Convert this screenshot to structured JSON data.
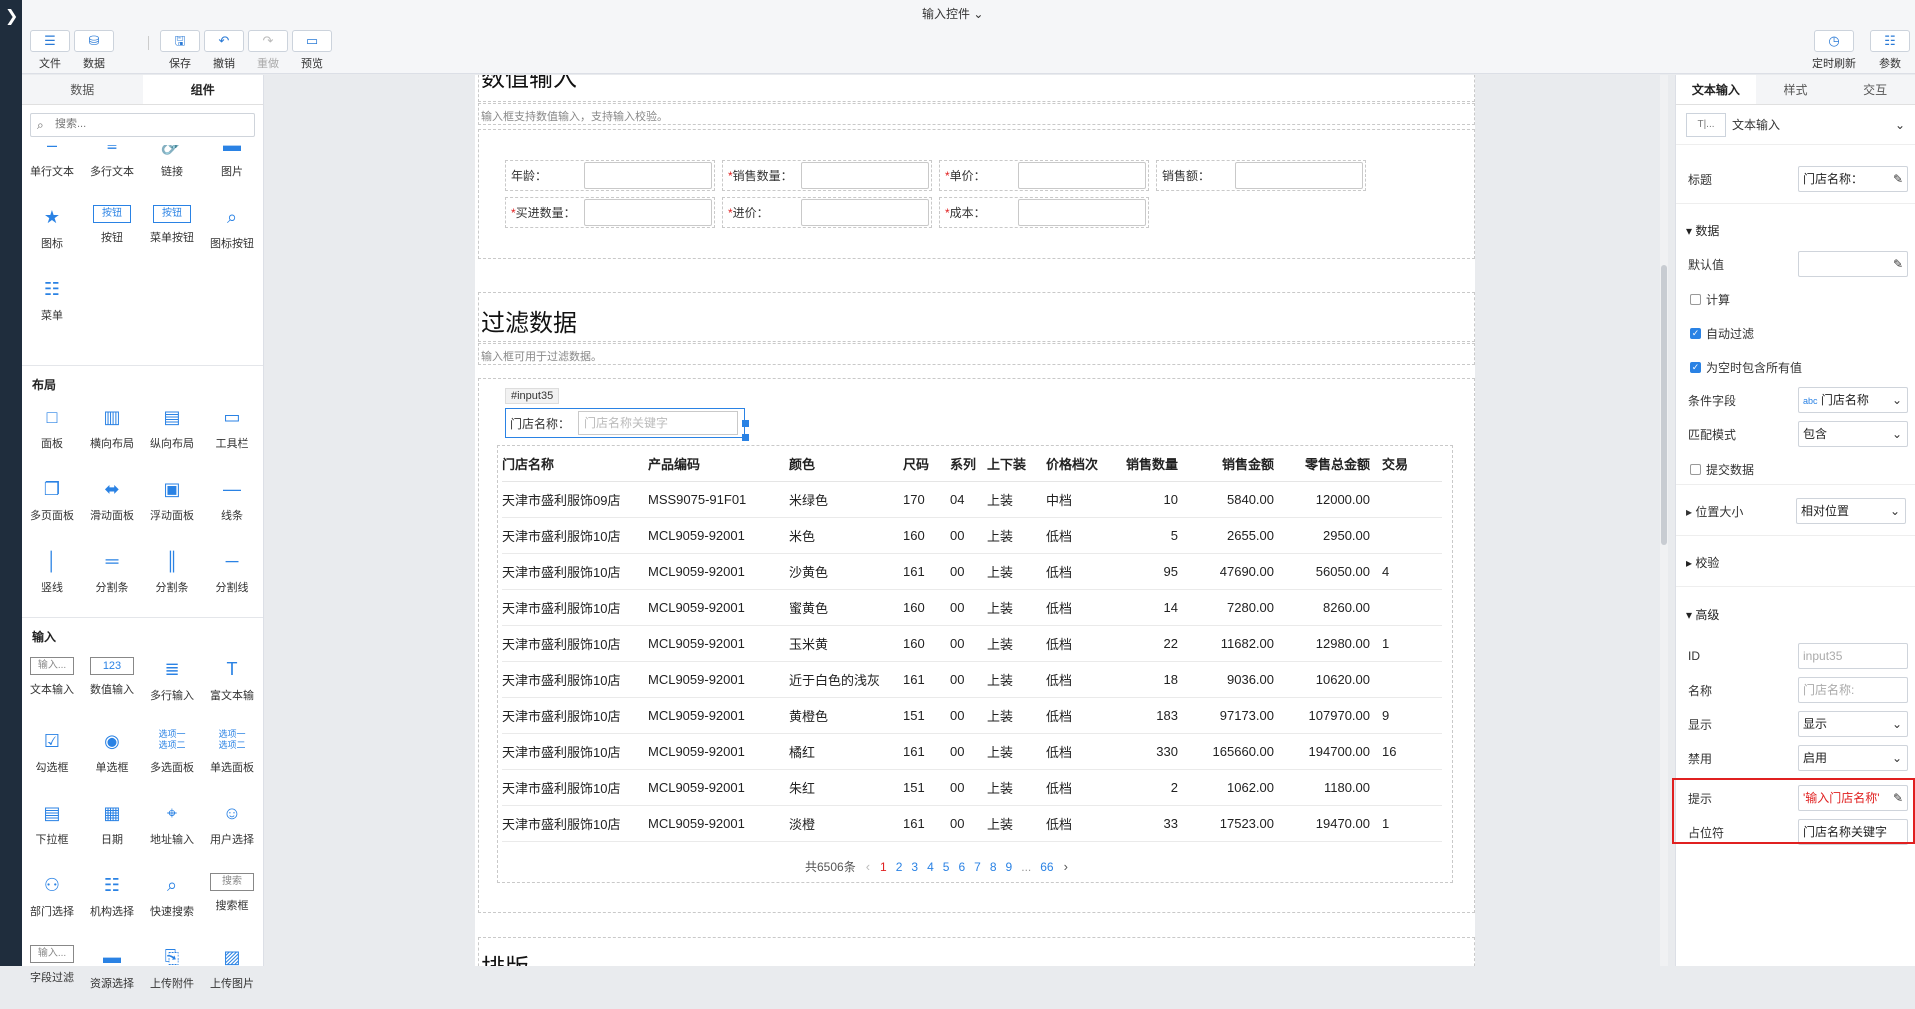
{
  "window_title": "输入控件",
  "toolbar": {
    "file": "文件",
    "data": "数据",
    "save": "保存",
    "undo": "撤销",
    "redo": "重做",
    "preview": "预览",
    "timed_refresh": "定时刷新",
    "params": "参数"
  },
  "left_panel": {
    "tabs": [
      "数据",
      "组件"
    ],
    "search_placeholder": "搜索...",
    "basic_items": [
      "单行文本",
      "多行文本",
      "链接",
      "图片",
      "图标",
      "按钮",
      "菜单按钮",
      "图标按钮",
      "菜单"
    ],
    "layout_title": "布局",
    "layout_items": [
      "面板",
      "横向布局",
      "纵向布局",
      "工具栏",
      "多页面板",
      "滑动面板",
      "浮动面板",
      "线条",
      "竖线",
      "分割条",
      "分割条",
      "分割线"
    ],
    "input_title": "输入",
    "input_items": [
      "文本输入",
      "数值输入",
      "多行输入",
      "富文本输",
      "勾选框",
      "单选框",
      "多选面板",
      "单选面板",
      "下拉框",
      "日期",
      "地址输入",
      "用户选择",
      "部门选择",
      "机构选择",
      "快速搜索",
      "搜索框",
      "字段过滤",
      "资源选择",
      "上传附件",
      "上传图片"
    ],
    "icon_labels": {
      "button_text": "按钮",
      "menu_button_text": "按钮",
      "input_text": "输入...",
      "number_text": "123",
      "opt1": "选项一",
      "opt2": "选项二",
      "search_text": "搜索",
      "filter_text": "输入..."
    }
  },
  "canvas": {
    "section1": {
      "title": "数值输入",
      "desc": "输入框支持数值输入，支持输入校验。",
      "fields": [
        {
          "label": "年龄：",
          "required": false
        },
        {
          "label": "销售数量：",
          "required": true
        },
        {
          "label": "单价：",
          "required": true
        },
        {
          "label": "销售额：",
          "required": false
        },
        {
          "label": "买进数量：",
          "required": true
        },
        {
          "label": "进价：",
          "required": true
        },
        {
          "label": "成本：",
          "required": true
        }
      ]
    },
    "section2": {
      "title": "过滤数据",
      "desc": "输入框可用于过滤数据。",
      "selected_tag": "#input35",
      "input_label": "门店名称：",
      "input_placeholder": "门店名称关键字",
      "table": {
        "columns": [
          "门店名称",
          "产品编码",
          "颜色",
          "尺码",
          "系列",
          "上下装",
          "价格档次",
          "销售数量",
          "销售金额",
          "零售总金额",
          "交易"
        ],
        "rows": [
          [
            "天津市盛利服饰09店",
            "MSS9075-91F01",
            "米绿色",
            "170",
            "04",
            "上装",
            "中档",
            "10",
            "5840.00",
            "12000.00",
            ""
          ],
          [
            "天津市盛利服饰10店",
            "MCL9059-92001",
            "米色",
            "160",
            "00",
            "上装",
            "低档",
            "5",
            "2655.00",
            "2950.00",
            ""
          ],
          [
            "天津市盛利服饰10店",
            "MCL9059-92001",
            "沙黄色",
            "161",
            "00",
            "上装",
            "低档",
            "95",
            "47690.00",
            "56050.00",
            "4"
          ],
          [
            "天津市盛利服饰10店",
            "MCL9059-92001",
            "蜜黄色",
            "160",
            "00",
            "上装",
            "低档",
            "14",
            "7280.00",
            "8260.00",
            ""
          ],
          [
            "天津市盛利服饰10店",
            "MCL9059-92001",
            "玉米黄",
            "160",
            "00",
            "上装",
            "低档",
            "22",
            "11682.00",
            "12980.00",
            "1"
          ],
          [
            "天津市盛利服饰10店",
            "MCL9059-92001",
            "近于白色的浅灰",
            "161",
            "00",
            "上装",
            "低档",
            "18",
            "9036.00",
            "10620.00",
            ""
          ],
          [
            "天津市盛利服饰10店",
            "MCL9059-92001",
            "黄橙色",
            "151",
            "00",
            "上装",
            "低档",
            "183",
            "97173.00",
            "107970.00",
            "9"
          ],
          [
            "天津市盛利服饰10店",
            "MCL9059-92001",
            "橘红",
            "161",
            "00",
            "上装",
            "低档",
            "330",
            "165660.00",
            "194700.00",
            "16"
          ],
          [
            "天津市盛利服饰10店",
            "MCL9059-92001",
            "朱红",
            "151",
            "00",
            "上装",
            "低档",
            "2",
            "1062.00",
            "1180.00",
            ""
          ],
          [
            "天津市盛利服饰10店",
            "MCL9059-92001",
            "淡橙",
            "161",
            "00",
            "上装",
            "低档",
            "33",
            "17523.00",
            "19470.00",
            "1"
          ]
        ]
      },
      "pager": {
        "total": "共6506条",
        "pages": [
          "1",
          "2",
          "3",
          "4",
          "5",
          "6",
          "7",
          "8",
          "9",
          "...",
          "66"
        ],
        "current": "1"
      }
    },
    "section3": {
      "title": "排版"
    }
  },
  "right_panel": {
    "tabs": [
      "文本输入",
      "样式",
      "交互"
    ],
    "component_name": "文本输入",
    "component_icon_text": "T|...",
    "title_label": "标题",
    "title_value": "门店名称：",
    "data_group": "数据",
    "default_label": "默认值",
    "default_value": "",
    "calc_label": "计算",
    "auto_filter_label": "自动过滤",
    "empty_all_label": "为空时包含所有值",
    "cond_field_label": "条件字段",
    "cond_field_prefix": "abc",
    "cond_field_value": "门店名称",
    "match_label": "匹配模式",
    "match_value": "包含",
    "submit_label": "提交数据",
    "pos_group": "位置大小",
    "pos_value": "相对位置",
    "validate_group": "校验",
    "advanced_group": "高级",
    "id_label": "ID",
    "id_value": "input35",
    "name_label": "名称",
    "name_value": "门店名称:",
    "display_label": "显示",
    "display_value": "显示",
    "disable_label": "禁用",
    "disable_value": "启用",
    "hint_label": "提示",
    "hint_value": "'输入门店名称'",
    "placeholder_label": "占位符",
    "placeholder_value": "门店名称关键字"
  },
  "colors": {
    "accent": "#2a82e4",
    "highlight_red": "#e02020",
    "sidebar_dark": "#1f2d3d"
  }
}
